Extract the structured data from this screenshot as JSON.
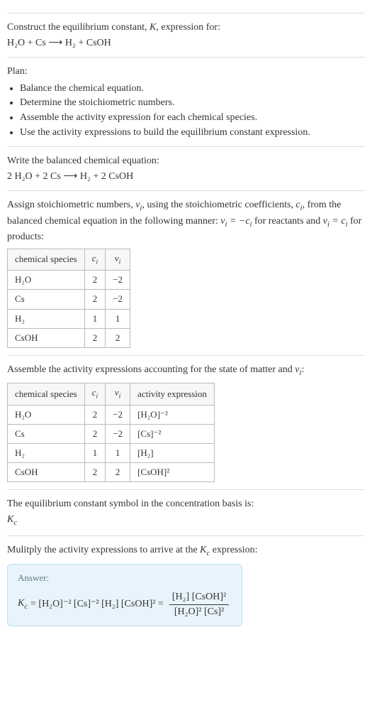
{
  "intro": {
    "line1_a": "Construct the equilibrium constant, ",
    "line1_k": "K",
    "line1_b": ", expression for:",
    "equation": "H₂O + Cs ⟶ H₂ + CsOH"
  },
  "plan": {
    "heading": "Plan:",
    "items": [
      "Balance the chemical equation.",
      "Determine the stoichiometric numbers.",
      "Assemble the activity expression for each chemical species.",
      "Use the activity expressions to build the equilibrium constant expression."
    ]
  },
  "balanced": {
    "heading": "Write the balanced chemical equation:",
    "equation": "2 H₂O + 2 Cs ⟶ H₂ + 2 CsOH"
  },
  "stoich": {
    "text_a": "Assign stoichiometric numbers, ",
    "nu": "ν",
    "sub_i": "i",
    "text_b": ", using the stoichiometric coefficients, ",
    "c": "c",
    "text_c": ", from the balanced chemical equation in the following manner: ",
    "rel_reactants_lhs": "ν_i = −c_i",
    "text_d": " for reactants and ",
    "rel_products_lhs": "ν_i = c_i",
    "text_e": " for products:",
    "headers": {
      "species": "chemical species",
      "ci": "cᵢ",
      "nui": "νᵢ"
    },
    "rows": [
      {
        "species": "H₂O",
        "ci": "2",
        "nui": "−2"
      },
      {
        "species": "Cs",
        "ci": "2",
        "nui": "−2"
      },
      {
        "species": "H₂",
        "ci": "1",
        "nui": "1"
      },
      {
        "species": "CsOH",
        "ci": "2",
        "nui": "2"
      }
    ]
  },
  "activity": {
    "text_a": "Assemble the activity expressions accounting for the state of matter and ",
    "nu": "ν",
    "sub_i": "i",
    "text_b": ":",
    "headers": {
      "species": "chemical species",
      "ci": "cᵢ",
      "nui": "νᵢ",
      "act": "activity expression"
    },
    "rows": [
      {
        "species": "H₂O",
        "ci": "2",
        "nui": "−2",
        "act": "[H₂O]⁻²"
      },
      {
        "species": "Cs",
        "ci": "2",
        "nui": "−2",
        "act": "[Cs]⁻²"
      },
      {
        "species": "H₂",
        "ci": "1",
        "nui": "1",
        "act": "[H₂]"
      },
      {
        "species": "CsOH",
        "ci": "2",
        "nui": "2",
        "act": "[CsOH]²"
      }
    ]
  },
  "symbol": {
    "text": "The equilibrium constant symbol in the concentration basis is:",
    "k": "K",
    "sub": "c"
  },
  "multiply": {
    "text_a": "Mulitply the activity expressions to arrive at the ",
    "k": "K",
    "sub": "c",
    "text_b": " expression:"
  },
  "answer": {
    "label": "Answer:",
    "kc_k": "K",
    "kc_sub": "c",
    "eq_flat": " = [H₂O]⁻² [Cs]⁻² [H₂] [CsOH]² = ",
    "num": "[H₂] [CsOH]²",
    "den": "[H₂O]² [Cs]²"
  },
  "chart_data": {
    "type": "table",
    "tables": [
      {
        "title": "stoichiometric numbers",
        "columns": [
          "chemical species",
          "cᵢ",
          "νᵢ"
        ],
        "rows": [
          [
            "H₂O",
            2,
            -2
          ],
          [
            "Cs",
            2,
            -2
          ],
          [
            "H₂",
            1,
            1
          ],
          [
            "CsOH",
            2,
            2
          ]
        ]
      },
      {
        "title": "activity expressions",
        "columns": [
          "chemical species",
          "cᵢ",
          "νᵢ",
          "activity expression"
        ],
        "rows": [
          [
            "H₂O",
            2,
            -2,
            "[H₂O]⁻²"
          ],
          [
            "Cs",
            2,
            -2,
            "[Cs]⁻²"
          ],
          [
            "H₂",
            1,
            1,
            "[H₂]"
          ],
          [
            "CsOH",
            2,
            2,
            "[CsOH]²"
          ]
        ]
      }
    ]
  }
}
